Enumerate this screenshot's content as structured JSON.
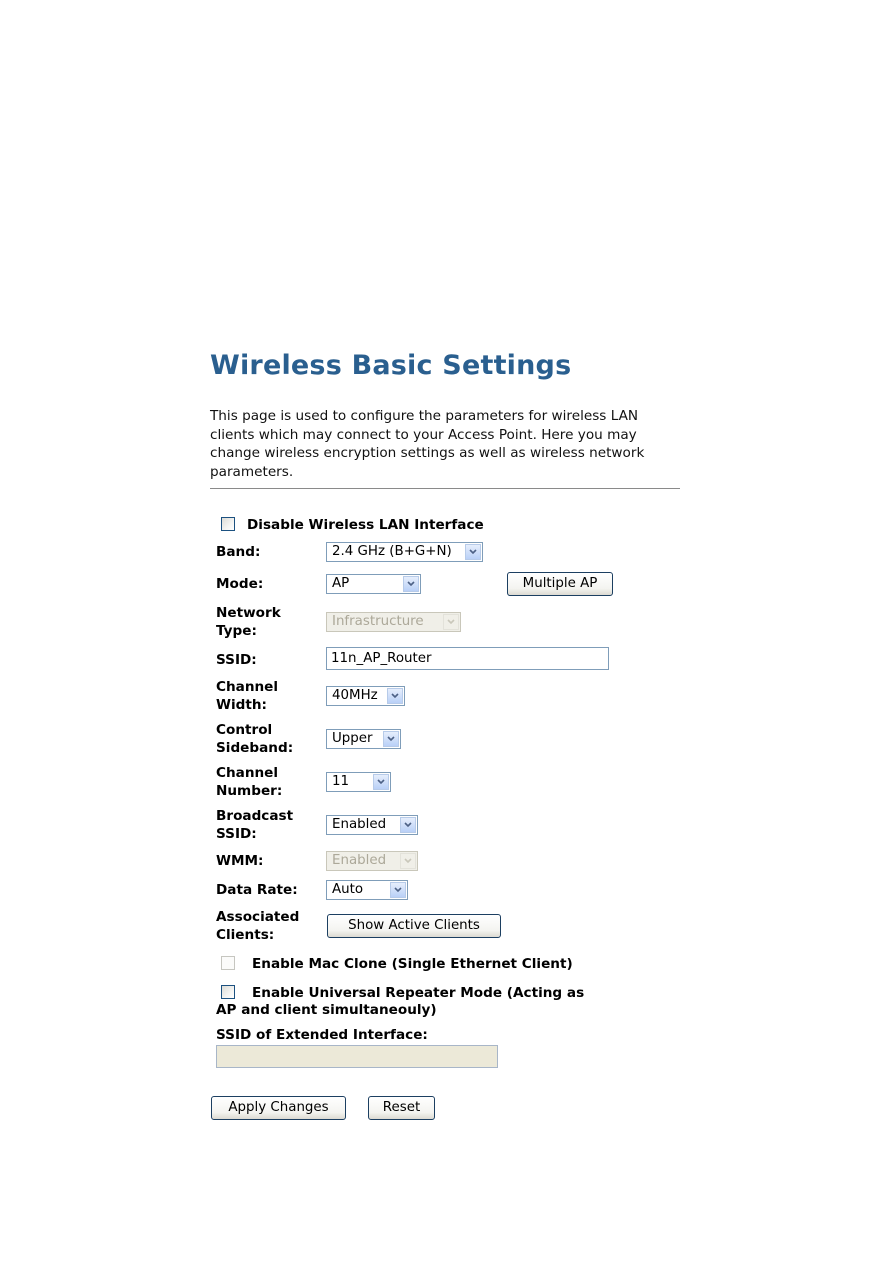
{
  "page": {
    "title": "Wireless Basic Settings",
    "description": "This page is used to configure the parameters for wireless LAN clients which may connect to your Access Point. Here you may change wireless encryption settings as well as wireless network parameters."
  },
  "form": {
    "disable_wlan": {
      "label": "Disable Wireless LAN Interface",
      "checked": false
    },
    "band": {
      "label": "Band:",
      "value": "2.4 GHz (B+G+N)"
    },
    "mode": {
      "label": "Mode:",
      "value": "AP"
    },
    "multiple_ap_button": "Multiple AP",
    "network_type": {
      "label_line1": "Network",
      "label_line2": "Type:",
      "value": "Infrastructure",
      "disabled": true
    },
    "ssid": {
      "label": "SSID:",
      "value": "11n_AP_Router"
    },
    "channel_width": {
      "label_line1": "Channel",
      "label_line2": "Width:",
      "value": "40MHz"
    },
    "control_sideband": {
      "label_line1": "Control",
      "label_line2": "Sideband:",
      "value": "Upper"
    },
    "channel_number": {
      "label_line1": "Channel",
      "label_line2": "Number:",
      "value": "11"
    },
    "broadcast_ssid": {
      "label_line1": "Broadcast",
      "label_line2": "SSID:",
      "value": "Enabled"
    },
    "wmm": {
      "label": "WMM:",
      "value": "Enabled",
      "disabled": true
    },
    "data_rate": {
      "label": "Data Rate:",
      "value": "Auto"
    },
    "associated_clients": {
      "label_line1": "Associated",
      "label_line2": "Clients:",
      "button": "Show Active Clients"
    },
    "mac_clone": {
      "label": "Enable Mac Clone (Single Ethernet Client)",
      "checked": false,
      "disabled": true
    },
    "universal_repeater": {
      "label_line1": "Enable Universal Repeater Mode (Acting as",
      "label_line2": "AP and client simultaneouly)",
      "checked": false
    },
    "extended_ssid": {
      "label": "SSID of Extended Interface:",
      "value": "",
      "disabled": true
    }
  },
  "actions": {
    "apply": "Apply Changes",
    "reset": "Reset"
  }
}
